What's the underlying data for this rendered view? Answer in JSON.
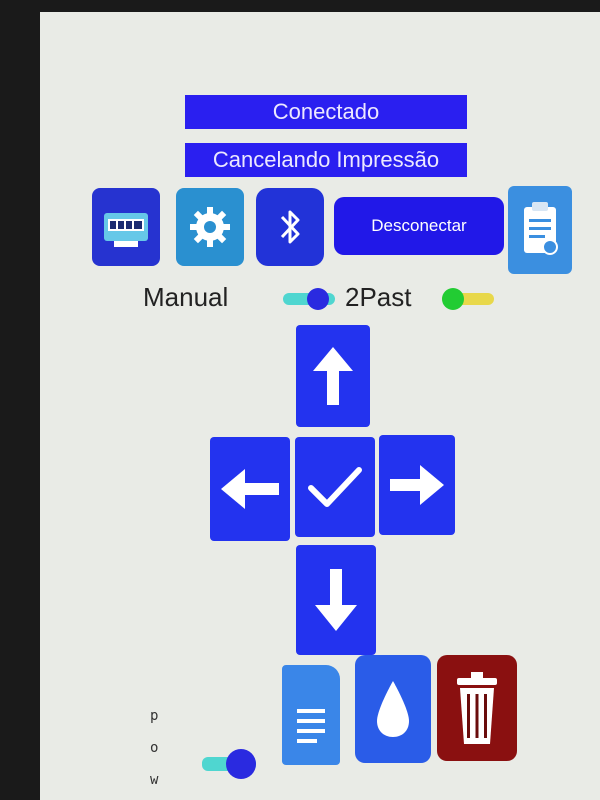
{
  "status": {
    "connection": "Conectado",
    "job": "Cancelando Impressão"
  },
  "toolbar": {
    "printer_icon": "printer-icon",
    "settings_icon": "gear-icon",
    "bluetooth_icon": "bluetooth-icon",
    "disconnect_label": "Desconectar",
    "clipboard_icon": "clipboard-icon"
  },
  "switches": {
    "mode_label": "Manual",
    "mode_on": true,
    "paste_label": "2Past",
    "paste_on": true,
    "pow_letters": [
      "p",
      "o",
      "w"
    ],
    "pow_on": true
  },
  "dpad": {
    "up": "arrow-up-icon",
    "left": "arrow-left-icon",
    "ok": "check-icon",
    "right": "arrow-right-icon",
    "down": "arrow-down-icon"
  },
  "bottom": {
    "document": "document-icon",
    "ink": "drop-icon",
    "delete": "trash-icon"
  },
  "colors": {
    "primary_blue": "#2333ef",
    "switch_blue": "#2a2ae0",
    "switch_track": "#4fd6d0",
    "switch_green": "#22cc33",
    "switch_yellow": "#e8d84a",
    "trash_red": "#8a1010"
  }
}
